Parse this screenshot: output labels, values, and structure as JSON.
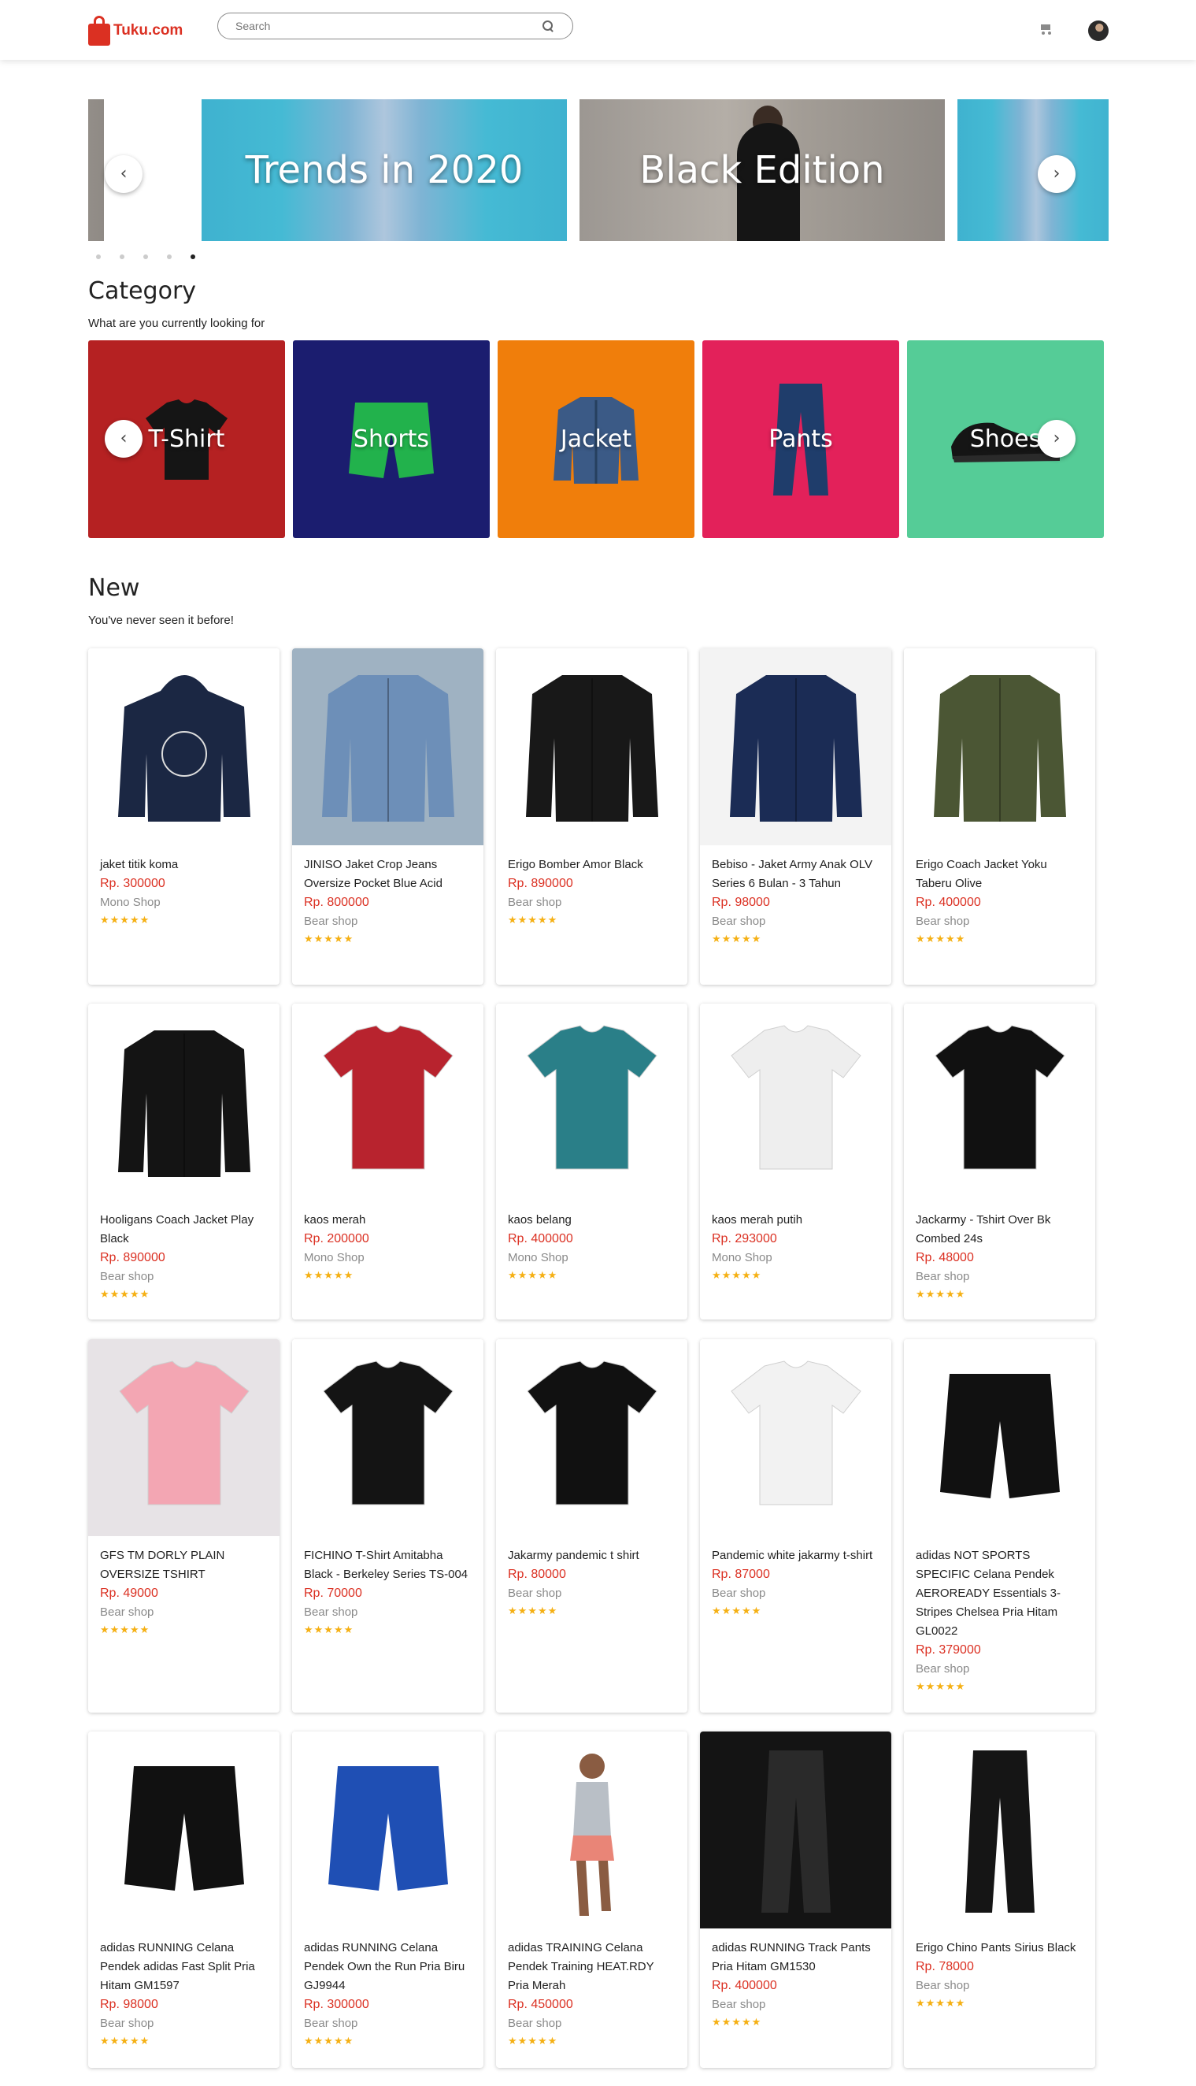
{
  "header": {
    "logo_text": "Tuku.com",
    "search_placeholder": "Search"
  },
  "carousel": {
    "slides": [
      "Trends in 2020",
      "Black Edition"
    ],
    "dots": 5,
    "active_dot": 5
  },
  "category": {
    "title": "Category",
    "subtitle": "What are you currently looking for",
    "items": [
      {
        "label": "T-Shirt",
        "color": "#b52122"
      },
      {
        "label": "Shorts",
        "color": "#1b1d6f"
      },
      {
        "label": "Jacket",
        "color": "#f07e0b"
      },
      {
        "label": "Pants",
        "color": "#e3215a"
      },
      {
        "label": "Shoes",
        "color": "#55cc97"
      }
    ]
  },
  "new": {
    "title": "New",
    "subtitle": "You've never seen it before!",
    "rating_stars": "★★★★★",
    "products": [
      {
        "name": "jaket titik koma",
        "price": "Rp. 300000",
        "seller": "Mono Shop"
      },
      {
        "name": "JINISO Jaket Crop Jeans Oversize Pocket Blue Acid",
        "price": "Rp. 800000",
        "seller": "Bear shop"
      },
      {
        "name": "Erigo Bomber Amor Black",
        "price": "Rp. 890000",
        "seller": "Bear shop"
      },
      {
        "name": "Bebiso - Jaket Army Anak OLV Series 6 Bulan - 3 Tahun",
        "price": "Rp. 98000",
        "seller": "Bear shop"
      },
      {
        "name": "Erigo Coach Jacket Yoku Taberu Olive",
        "price": "Rp. 400000",
        "seller": "Bear shop"
      },
      {
        "name": "Hooligans Coach Jacket Play Black",
        "price": "Rp. 890000",
        "seller": "Bear shop"
      },
      {
        "name": "kaos merah",
        "price": "Rp. 200000",
        "seller": "Mono Shop"
      },
      {
        "name": "kaos belang",
        "price": "Rp. 400000",
        "seller": "Mono Shop"
      },
      {
        "name": "kaos merah putih",
        "price": "Rp. 293000",
        "seller": "Mono Shop"
      },
      {
        "name": "Jackarmy - Tshirt Over Bk Combed 24s",
        "price": "Rp. 48000",
        "seller": "Bear shop"
      },
      {
        "name": "GFS TM DORLY PLAIN OVERSIZE TSHIRT",
        "price": "Rp. 49000",
        "seller": "Bear shop"
      },
      {
        "name": "FICHINO T-Shirt Amitabha Black - Berkeley Series TS-004",
        "price": "Rp. 70000",
        "seller": "Bear shop"
      },
      {
        "name": "Jakarmy pandemic t shirt",
        "price": "Rp. 80000",
        "seller": "Bear shop"
      },
      {
        "name": "Pandemic white jakarmy t-shirt",
        "price": "Rp. 87000",
        "seller": "Bear shop"
      },
      {
        "name": "adidas NOT SPORTS SPECIFIC Celana Pendek AEROREADY Essentials 3-Stripes Chelsea Pria Hitam GL0022",
        "price": "Rp. 379000",
        "seller": "Bear shop"
      },
      {
        "name": "adidas RUNNING Celana Pendek adidas Fast Split Pria Hitam GM1597",
        "price": "Rp. 98000",
        "seller": "Bear shop"
      },
      {
        "name": "adidas RUNNING Celana Pendek Own the Run Pria Biru GJ9944",
        "price": "Rp. 300000",
        "seller": "Bear shop"
      },
      {
        "name": "adidas TRAINING Celana Pendek Training HEAT.RDY Pria Merah",
        "price": "Rp. 450000",
        "seller": "Bear shop"
      },
      {
        "name": "adidas RUNNING Track Pants Pria Hitam GM1530",
        "price": "Rp. 400000",
        "seller": "Bear shop"
      },
      {
        "name": "Erigo Chino Pants Sirius Black",
        "price": "Rp. 78000",
        "seller": "Bear shop"
      }
    ]
  }
}
